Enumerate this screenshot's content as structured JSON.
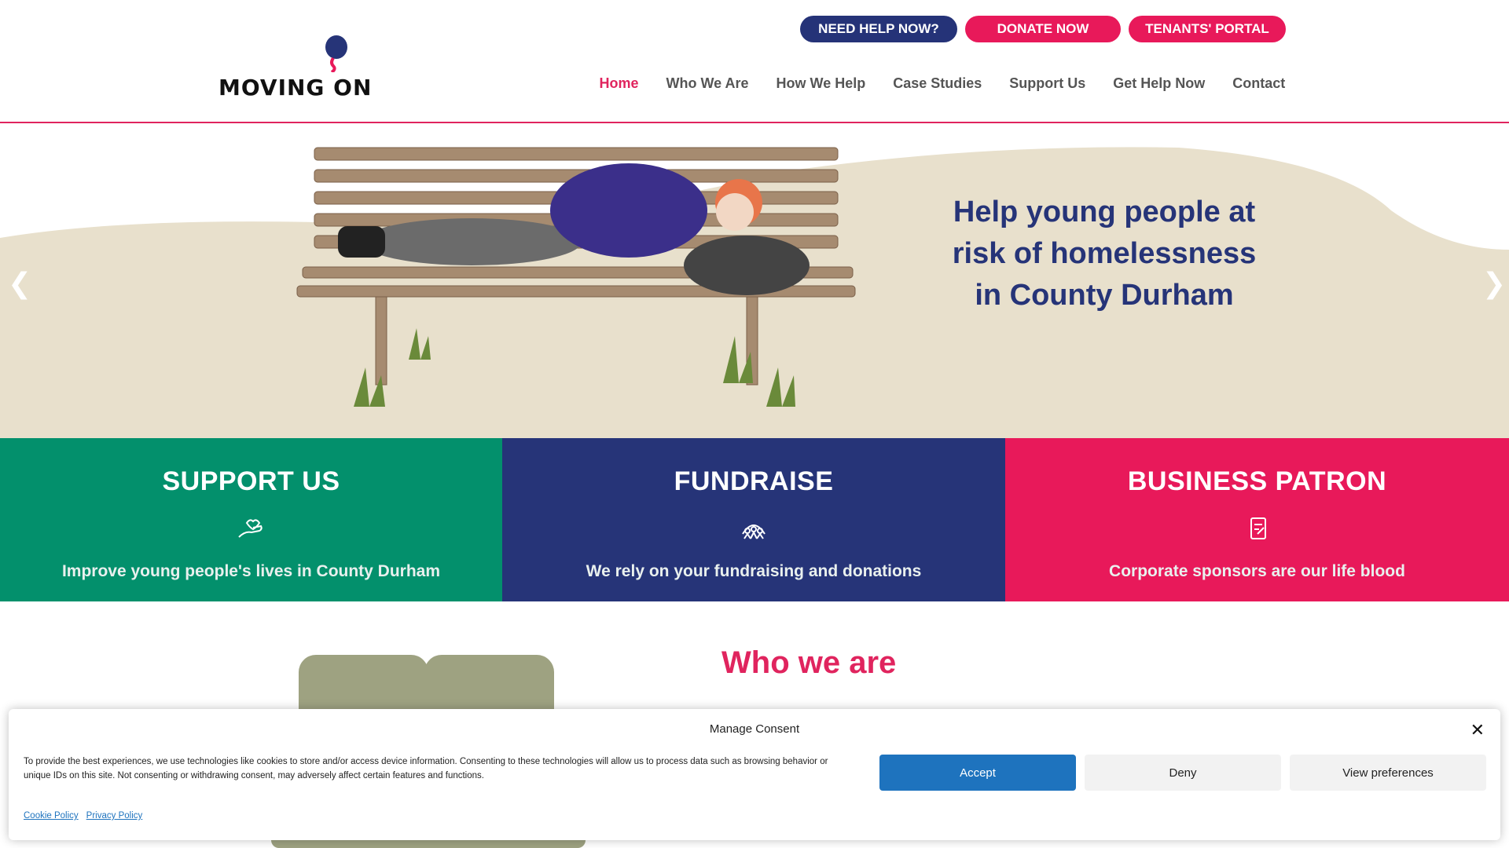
{
  "logo": {
    "text": "MOVING ON"
  },
  "top_buttons": {
    "need_help": "NEED HELP NOW?",
    "donate": "DONATE NOW",
    "tenants": "TENANTS' PORTAL"
  },
  "nav": {
    "items": [
      {
        "label": "Home",
        "active": true
      },
      {
        "label": "Who We Are",
        "active": false
      },
      {
        "label": "How We Help",
        "active": false
      },
      {
        "label": "Case Studies",
        "active": false
      },
      {
        "label": "Support Us",
        "active": false
      },
      {
        "label": "Get Help Now",
        "active": false
      },
      {
        "label": "Contact",
        "active": false
      }
    ]
  },
  "hero": {
    "line1": "Help young people at",
    "line2": "risk of homelessness",
    "line3": "in County Durham",
    "prev_icon": "chevron-left-icon",
    "next_icon": "chevron-right-icon"
  },
  "cards": [
    {
      "title": "SUPPORT US",
      "subtitle": "Improve young people's lives in County Durham",
      "icon": "hand-heart-icon",
      "color": "#03906c"
    },
    {
      "title": "FUNDRAISE",
      "subtitle": "We rely on your fundraising and donations",
      "icon": "group-people-icon",
      "color": "#263478"
    },
    {
      "title": "BUSINESS PATRON",
      "subtitle": "Corporate sponsors are our life blood",
      "icon": "certificate-icon",
      "color": "#e8195a"
    }
  ],
  "who_we_are": {
    "title": "Who we are"
  },
  "consent": {
    "title": "Manage Consent",
    "text": "To provide the best experiences, we use technologies like cookies to store and/or access device information. Consenting to these technologies will allow us to process data such as browsing behavior or unique IDs on this site. Not consenting or withdrawing consent, may adversely affect certain features and functions.",
    "accept": "Accept",
    "deny": "Deny",
    "view_preferences": "View preferences",
    "cookie_policy": "Cookie Policy",
    "privacy_policy": "Privacy Policy"
  },
  "colors": {
    "brand_pink": "#e8195a",
    "brand_navy": "#263478",
    "brand_green": "#03906c",
    "hero_bg": "#e8e0cc",
    "accept_blue": "#1e73be"
  }
}
